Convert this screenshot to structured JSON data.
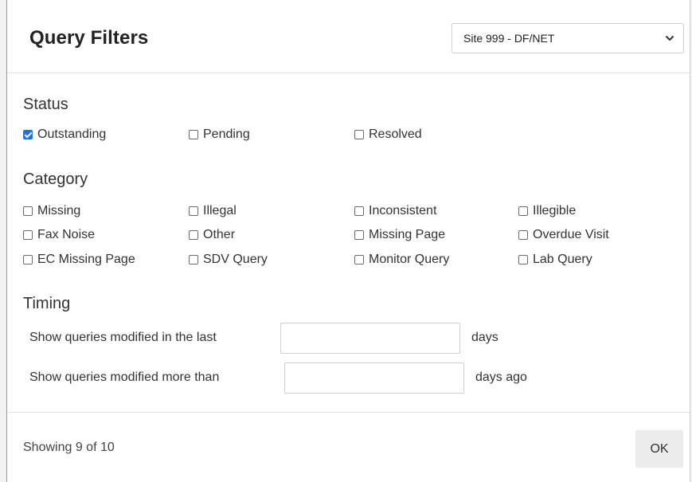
{
  "dialog": {
    "title": "Query Filters",
    "site_select": {
      "selected": "Site 999 - DF/NET",
      "icon": "chevron-down-icon"
    }
  },
  "status": {
    "label": "Status",
    "options": [
      {
        "label": "Outstanding",
        "checked": true
      },
      {
        "label": "Pending",
        "checked": false
      },
      {
        "label": "Resolved",
        "checked": false
      }
    ]
  },
  "category": {
    "label": "Category",
    "options": [
      {
        "label": "Missing",
        "checked": false
      },
      {
        "label": "Illegal",
        "checked": false
      },
      {
        "label": "Inconsistent",
        "checked": false
      },
      {
        "label": "Illegible",
        "checked": false
      },
      {
        "label": "Fax Noise",
        "checked": false
      },
      {
        "label": "Other",
        "checked": false
      },
      {
        "label": "Missing Page",
        "checked": false
      },
      {
        "label": "Overdue Visit",
        "checked": false
      },
      {
        "label": "EC Missing Page",
        "checked": false
      },
      {
        "label": "SDV Query",
        "checked": false
      },
      {
        "label": "Monitor Query",
        "checked": false
      },
      {
        "label": "Lab Query",
        "checked": false
      }
    ]
  },
  "timing": {
    "label": "Timing",
    "modified_last": {
      "prefix": "Show queries modified in the last",
      "value": "",
      "suffix": "days"
    },
    "modified_more": {
      "prefix": "Show queries modified more than",
      "value": "",
      "suffix": "days ago"
    }
  },
  "footer": {
    "showing": "Showing 9 of 10",
    "ok_label": "OK"
  },
  "colors": {
    "accent": "#1a73e8",
    "ok_button_bg": "#ececec"
  }
}
